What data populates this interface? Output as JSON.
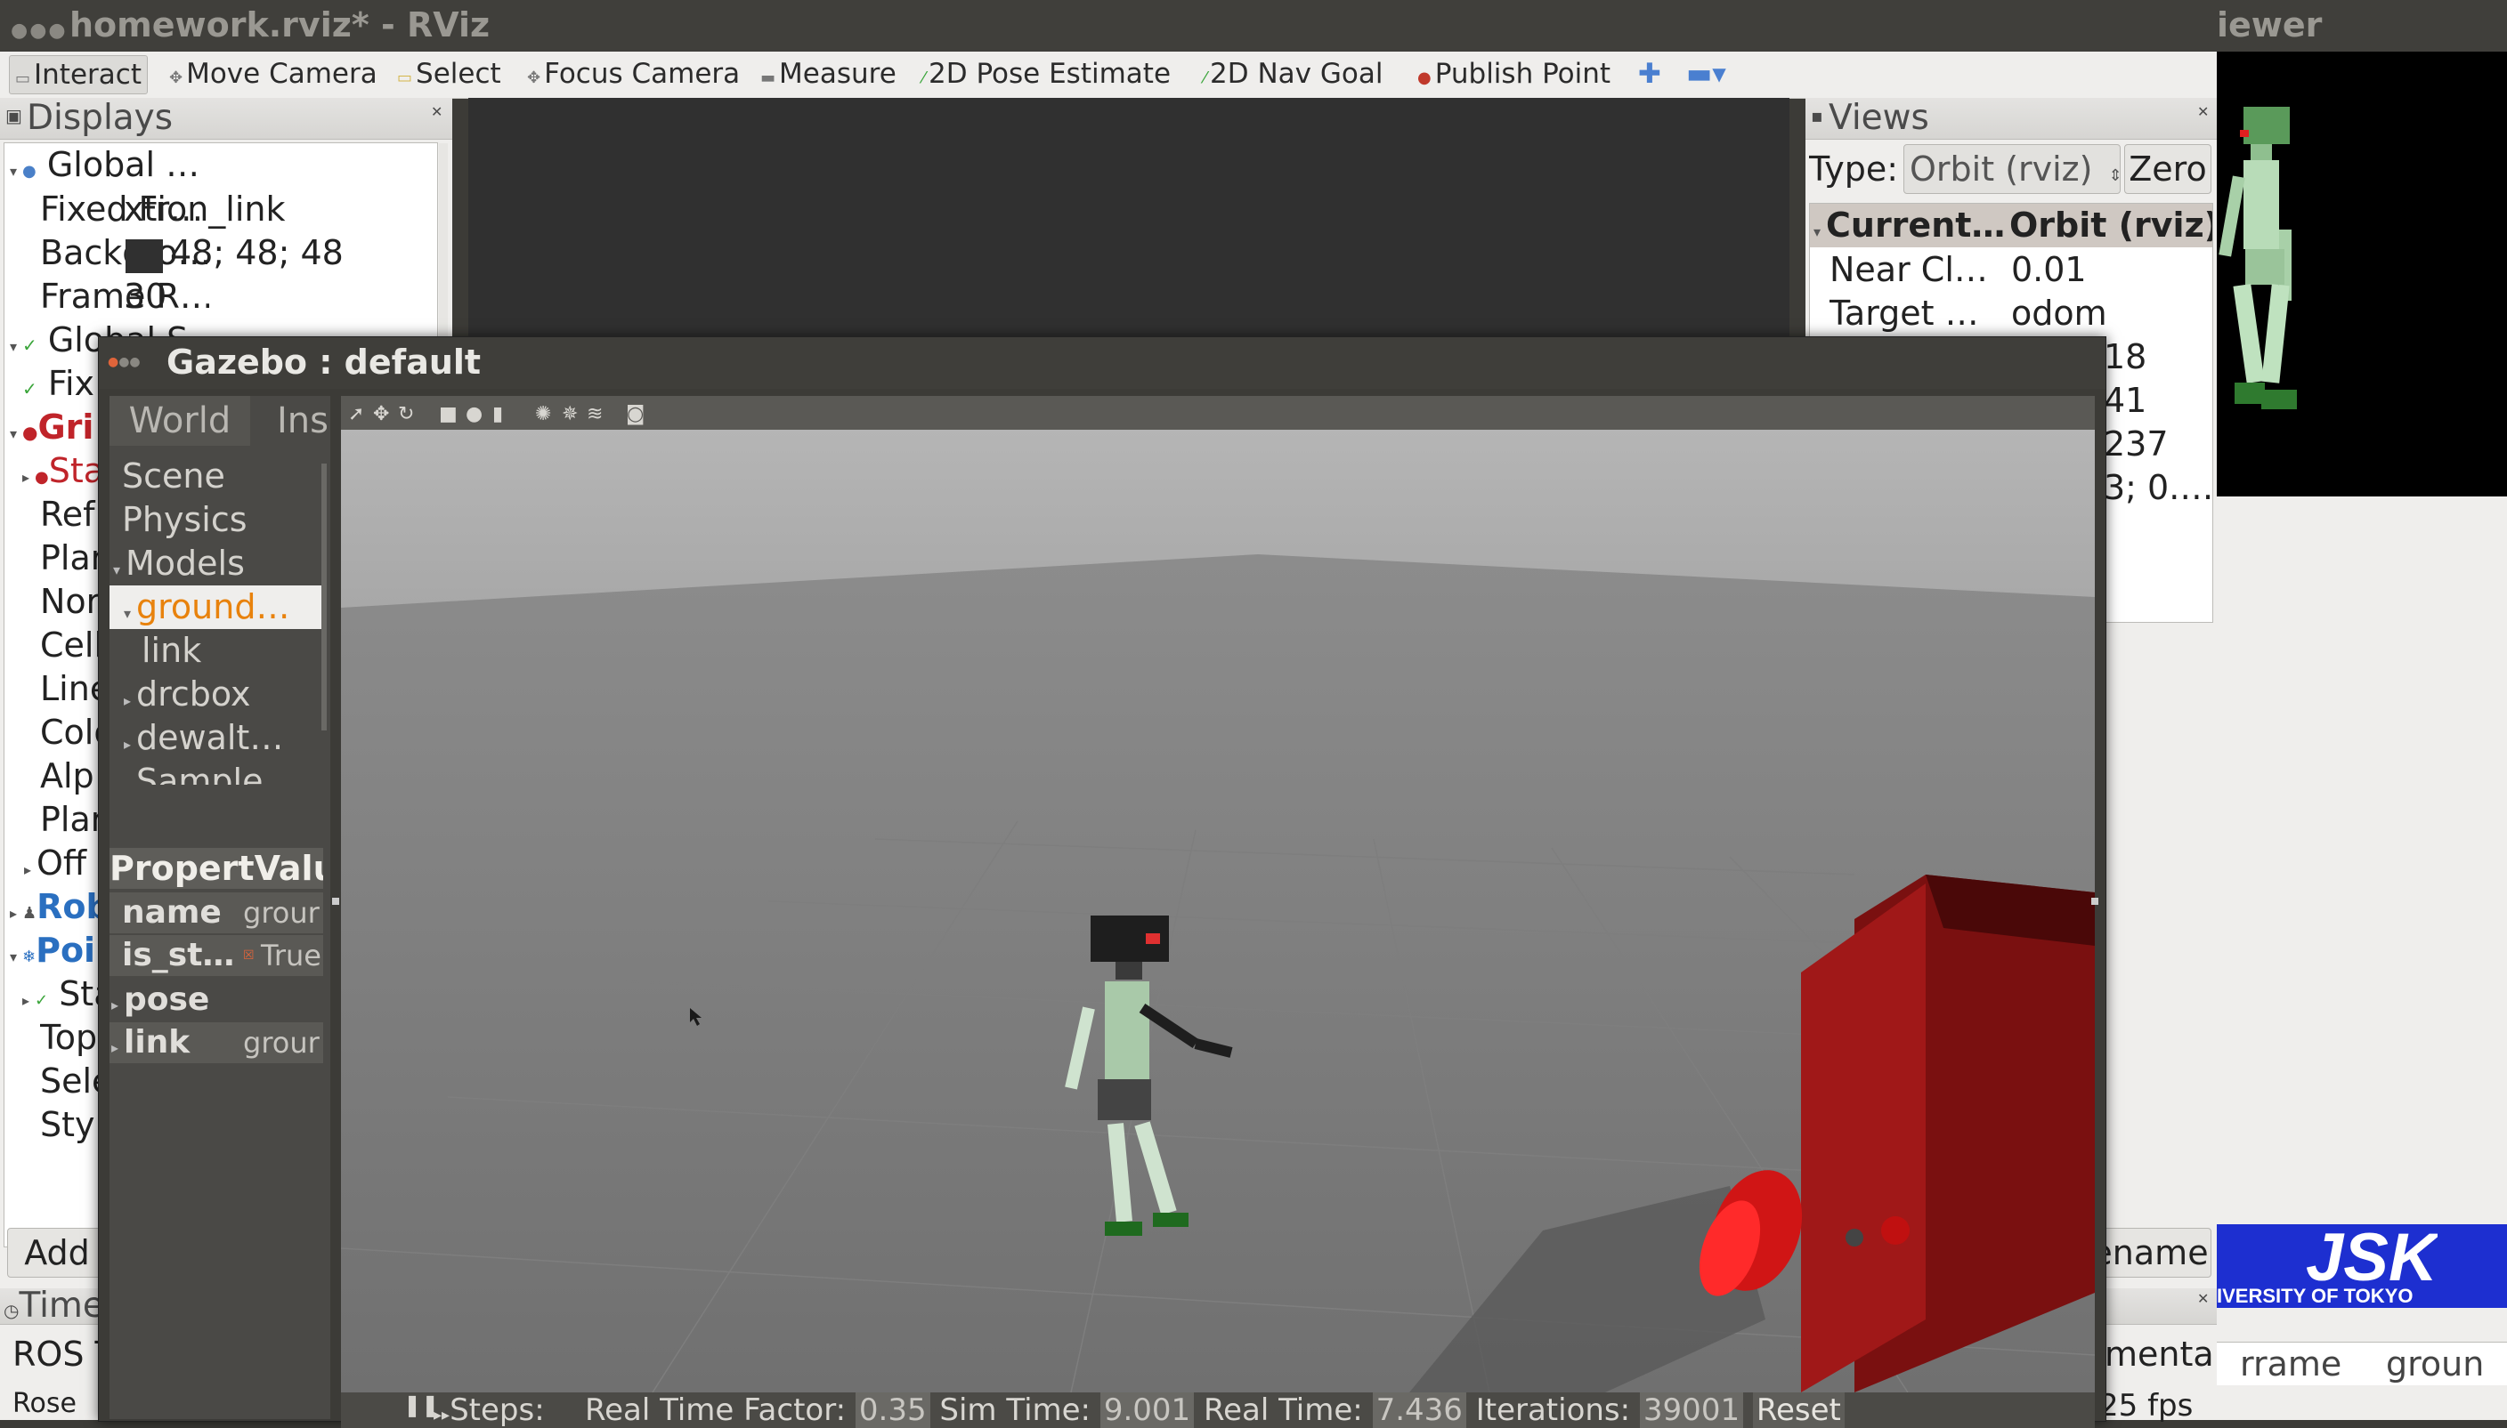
{
  "rviz": {
    "title": "homework.rviz* - RViz",
    "toolbar": [
      {
        "label": "Interact",
        "icon": "interact-icon"
      },
      {
        "label": "Move Camera",
        "icon": "move-camera-icon"
      },
      {
        "label": "Select",
        "icon": "select-icon"
      },
      {
        "label": "Focus Camera",
        "icon": "focus-camera-icon"
      },
      {
        "label": "Measure",
        "icon": "measure-icon"
      },
      {
        "label": "2D Pose Estimate",
        "icon": "pose-estimate-icon"
      },
      {
        "label": "2D Nav Goal",
        "icon": "nav-goal-icon"
      },
      {
        "label": "Publish Point",
        "icon": "publish-point-icon"
      }
    ],
    "displays": {
      "title": "Displays",
      "rows": [
        {
          "name": "Global …",
          "value": ""
        },
        {
          "name": "Fixed Fr…",
          "value": "xtion_link"
        },
        {
          "name": "Backgro…",
          "value": "48; 48; 48"
        },
        {
          "name": "Frame R…",
          "value": "30"
        },
        {
          "name": "Global S…",
          "value": ""
        },
        {
          "name": "Fix",
          "value": ""
        },
        {
          "name": "Gri",
          "value": ""
        },
        {
          "name": "Sta",
          "value": ""
        },
        {
          "name": "Ref",
          "value": ""
        },
        {
          "name": "Plar",
          "value": ""
        },
        {
          "name": "Nor",
          "value": ""
        },
        {
          "name": "Cell",
          "value": ""
        },
        {
          "name": "Line",
          "value": ""
        },
        {
          "name": "Colo",
          "value": ""
        },
        {
          "name": "Alp",
          "value": ""
        },
        {
          "name": "Plar",
          "value": ""
        },
        {
          "name": "Off",
          "value": ""
        },
        {
          "name": "Rob",
          "value": ""
        },
        {
          "name": "Poi",
          "value": ""
        },
        {
          "name": "Sta",
          "value": ""
        },
        {
          "name": "Top",
          "value": ""
        },
        {
          "name": "Sele",
          "value": ""
        },
        {
          "name": "Styl",
          "value": ""
        }
      ],
      "add_button": "Add",
      "time_title": "Time",
      "ros_time": "ROS T",
      "bottom_row": "Rose"
    },
    "views": {
      "title": "Views",
      "type_label": "Type:",
      "type_value": "Orbit (rviz)",
      "zero_button": "Zero",
      "header_name": "Current…",
      "header_value": "Orbit (rviz)",
      "rows": [
        {
          "name": "Near Cl…",
          "value": "0.01"
        },
        {
          "name": "Target …",
          "value": "odom"
        },
        {
          "name": "",
          "value": "18"
        },
        {
          "name": "",
          "value": "41"
        },
        {
          "name": "",
          "value": "237"
        },
        {
          "name": "",
          "value": "3; 0.…"
        }
      ],
      "rename_button": "ename",
      "experimental": "mental",
      "fps": "25 fps"
    }
  },
  "viewer": {
    "title": "iewer",
    "logo_main": "JSK",
    "logo_sub": "IVERSITY OF TOKYO",
    "frame_label": "rrame",
    "ground_label": "groun"
  },
  "gazebo": {
    "title": "Gazebo : default",
    "tabs": [
      "World",
      "Ins"
    ],
    "tree": [
      {
        "label": "Scene",
        "level": 0,
        "arrow": false
      },
      {
        "label": "Physics",
        "level": 0,
        "arrow": false
      },
      {
        "label": "Models",
        "level": 0,
        "arrow": true
      },
      {
        "label": "ground…",
        "level": 1,
        "arrow": true,
        "selected": true
      },
      {
        "label": "link",
        "level": 2,
        "arrow": false
      },
      {
        "label": "drcbox",
        "level": 1,
        "arrow": true
      },
      {
        "label": "dewalt…",
        "level": 1,
        "arrow": true
      },
      {
        "label": "Sample…",
        "level": 1,
        "arrow": true
      }
    ],
    "props_header": [
      "Propert",
      "Valu"
    ],
    "props": [
      {
        "name": "name",
        "value": "grour"
      },
      {
        "name": "is_st…",
        "value": "True"
      },
      {
        "name": "pose",
        "value": ""
      },
      {
        "name": "link",
        "value": "grour"
      }
    ],
    "status": {
      "steps_label": "Steps:",
      "rtf_label": "Real Time Factor:",
      "rtf_value": "0.35",
      "sim_label": "Sim Time:",
      "sim_value": "9.001",
      "real_label": "Real Time:",
      "real_value": "7.436",
      "iter_label": "Iterations:",
      "iter_value": "39001",
      "reset_button": "Reset"
    }
  },
  "colors": {
    "background_swatch": "#303030",
    "gazebo_red": "#8b1d1d",
    "jsk_blue": "#1226c8"
  }
}
